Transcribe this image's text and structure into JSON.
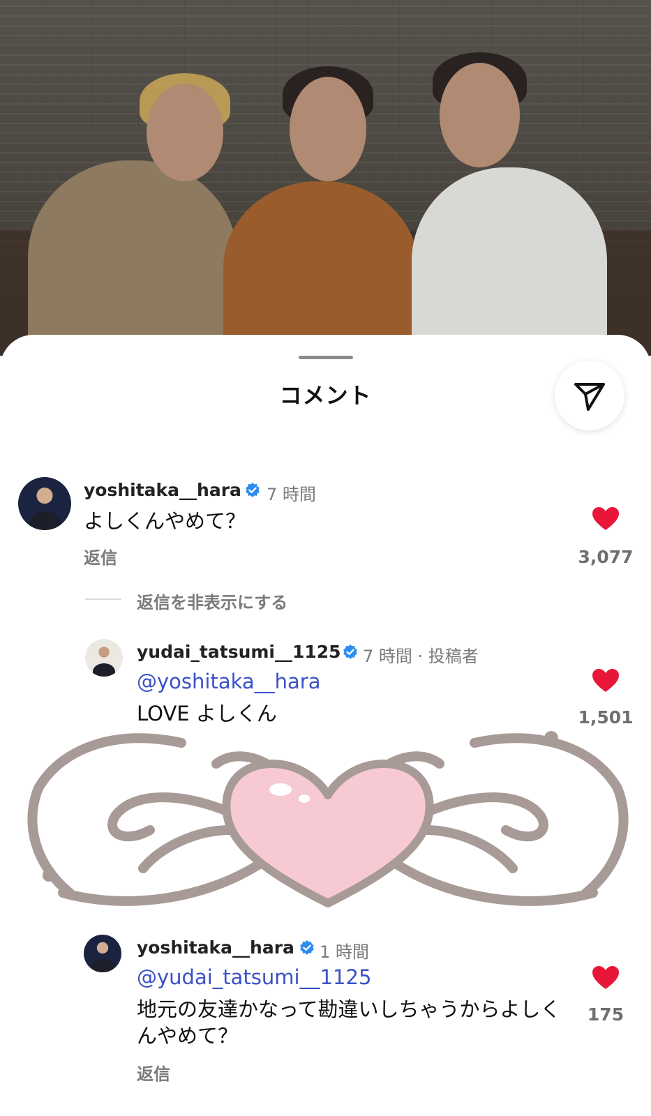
{
  "sheet": {
    "title": "コメント"
  },
  "comments": [
    {
      "username": "yoshitaka__hara",
      "time": "7 時間",
      "text": "よしくんやめて？",
      "reply_label": "返信",
      "likes": "3,077",
      "avatar_icon": "avatar-dark-suit"
    }
  ],
  "thread": {
    "hide_label": "返信を非表示にする"
  },
  "replies": [
    {
      "username": "yudai_tatsumi__1125",
      "time": "7 時間 · 投稿者",
      "mention": "@yoshitaka__hara",
      "text": "LOVE よしくん",
      "likes": "1,501",
      "avatar_icon": "avatar-light"
    },
    {
      "username": "yoshitaka__hara",
      "time": "1 時間",
      "mention": "@yudai_tatsumi__1125",
      "text": "地元の友達かなって勘違いしちゃうからよしくんやめて？",
      "reply_label": "返信",
      "likes": "175",
      "avatar_icon": "avatar-dark-suit"
    }
  ],
  "colors": {
    "heart": "#e8173a",
    "mention": "#3a51c8",
    "verified": "#2d8cf0",
    "sticker_outline": "#a89a96",
    "sticker_heart": "#f7c9d2"
  },
  "icons": {
    "share": "send-icon",
    "verified": "verified-badge-icon",
    "like": "heart-icon"
  }
}
